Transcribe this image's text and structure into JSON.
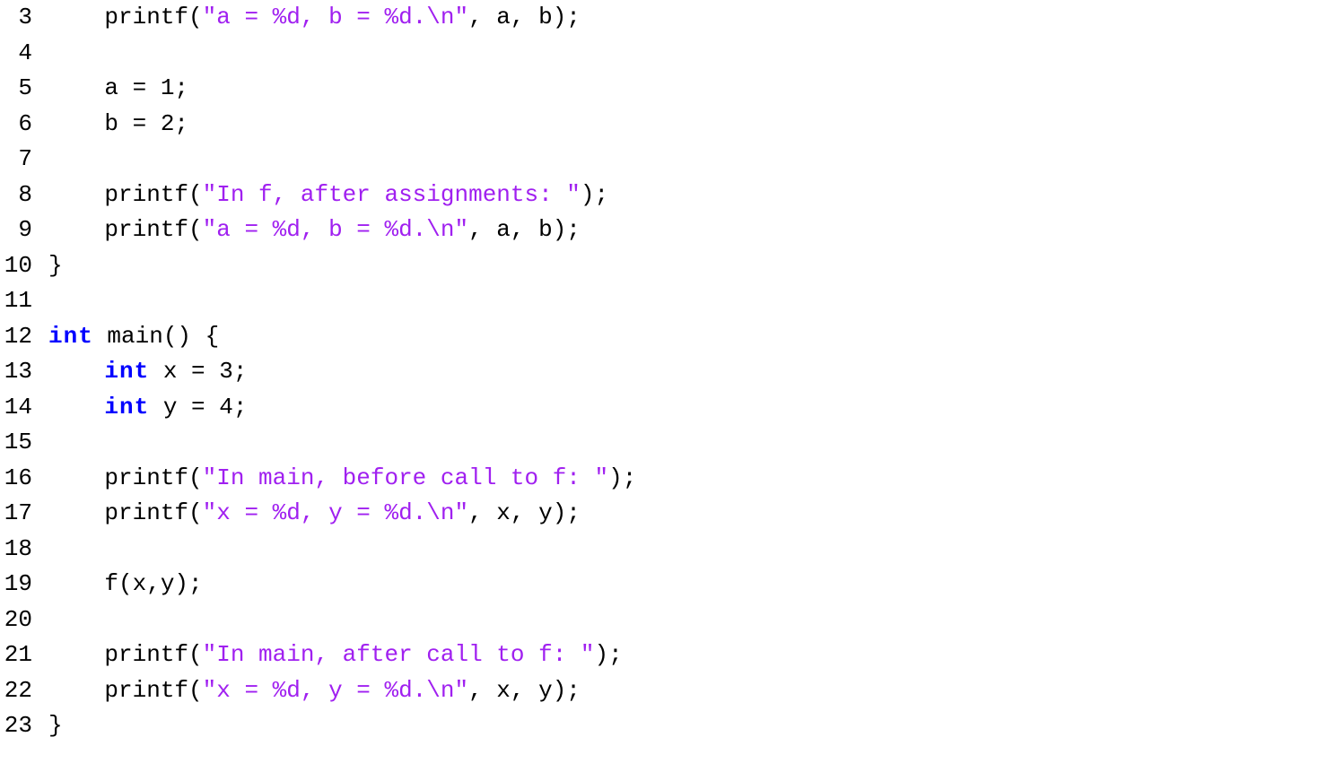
{
  "colors": {
    "keyword": "#0000ff",
    "string": "#a020f0",
    "text": "#000000",
    "background": "#ffffff"
  },
  "gutter": {
    "start": 3,
    "end": 23,
    "numbers": [
      "3",
      "4",
      "5",
      "6",
      "7",
      "8",
      "9",
      "10",
      "11",
      "12",
      "13",
      "14",
      "15",
      "16",
      "17",
      "18",
      "19",
      "20",
      "21",
      "22",
      "23"
    ]
  },
  "lines": {
    "l3": {
      "indent": "    ",
      "fn": "printf(",
      "str": "\"a = %d, b = %d.\\n\"",
      "rest": ", a, b);"
    },
    "l4": {
      "text": ""
    },
    "l5": {
      "text": "    a = 1;"
    },
    "l6": {
      "text": "    b = 2;"
    },
    "l7": {
      "text": ""
    },
    "l8": {
      "indent": "    ",
      "fn": "printf(",
      "str": "\"In f, after assignments: \"",
      "rest": ");"
    },
    "l9": {
      "indent": "    ",
      "fn": "printf(",
      "str": "\"a = %d, b = %d.\\n\"",
      "rest": ", a, b);"
    },
    "l10": {
      "text": "}"
    },
    "l11": {
      "text": ""
    },
    "l12": {
      "kw": "int",
      "rest": " main() {"
    },
    "l13": {
      "indent": "    ",
      "kw": "int",
      "rest": " x = 3;"
    },
    "l14": {
      "indent": "    ",
      "kw": "int",
      "rest": " y = 4;"
    },
    "l15": {
      "text": ""
    },
    "l16": {
      "indent": "    ",
      "fn": "printf(",
      "str": "\"In main, before call to f: \"",
      "rest": ");"
    },
    "l17": {
      "indent": "    ",
      "fn": "printf(",
      "str": "\"x = %d, y = %d.\\n\"",
      "rest": ", x, y);"
    },
    "l18": {
      "text": ""
    },
    "l19": {
      "text": "    f(x,y);"
    },
    "l20": {
      "text": ""
    },
    "l21": {
      "indent": "    ",
      "fn": "printf(",
      "str": "\"In main, after call to f: \"",
      "rest": ");"
    },
    "l22": {
      "indent": "    ",
      "fn": "printf(",
      "str": "\"x = %d, y = %d.\\n\"",
      "rest": ", x, y);"
    },
    "l23": {
      "text": "}"
    }
  }
}
